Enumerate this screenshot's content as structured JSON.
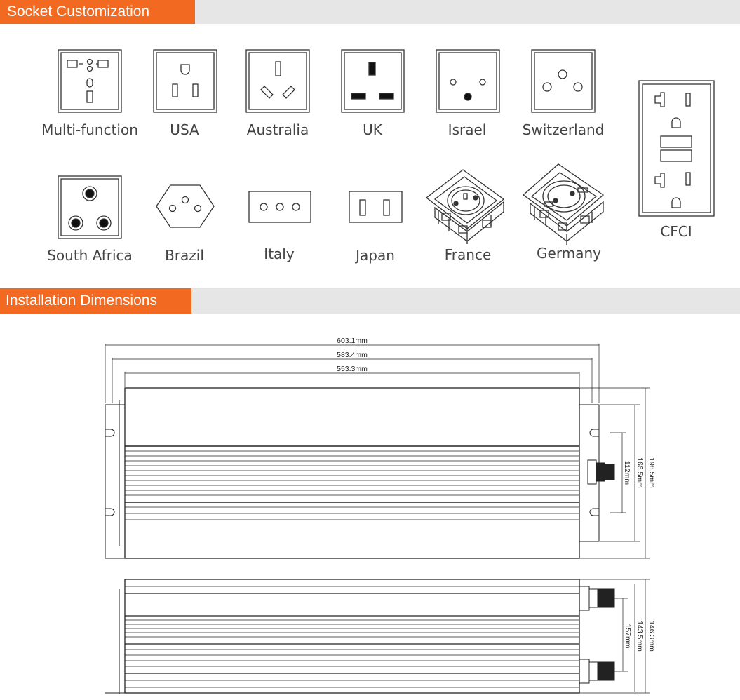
{
  "sections": {
    "socket": "Socket Customization",
    "install": "Installation Dimensions"
  },
  "sockets": [
    {
      "name": "Multi-function"
    },
    {
      "name": "USA"
    },
    {
      "name": "Australia"
    },
    {
      "name": "UK"
    },
    {
      "name": "Israel"
    },
    {
      "name": "Switzerland"
    },
    {
      "name": "CFCI"
    },
    {
      "name": "South Africa"
    },
    {
      "name": "Brazil"
    },
    {
      "name": "Italy"
    },
    {
      "name": "Japan"
    },
    {
      "name": "France"
    },
    {
      "name": "Germany"
    }
  ],
  "dimensions": {
    "top": {
      "overall": "603.1mm",
      "mount": "583.4mm",
      "body": "553.3mm",
      "height_total": "198.5mm",
      "height_mount": "166.5mm",
      "height_inner": "112mm"
    },
    "side": {
      "height_total": "146.3mm",
      "height_mount": "143.5mm",
      "height_inner": "157mm"
    }
  }
}
